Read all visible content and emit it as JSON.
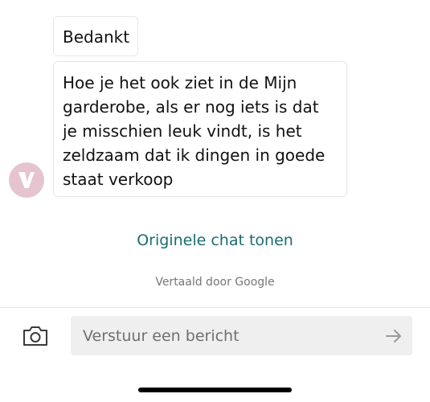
{
  "messages": [
    {
      "text": "Bedankt"
    },
    {
      "text": "Hoe je het ook ziet in de Mijn garderobe, als er nog iets is dat je misschien leuk vindt, is het zeldzaam dat ik dingen in goede staat verkoop"
    }
  ],
  "avatar": {
    "letter": "V",
    "color": "#e6c4cf"
  },
  "translation": {
    "show_original_label": "Originele chat tonen",
    "attribution": "Vertaald door Google"
  },
  "composer": {
    "placeholder": "Verstuur een bericht",
    "value": "",
    "camera_icon": "camera-icon",
    "send_icon": "arrow-right-icon"
  },
  "colors": {
    "accent": "#1a6c72",
    "avatar_bg": "#e6c4cf",
    "input_bg": "#efefef"
  }
}
